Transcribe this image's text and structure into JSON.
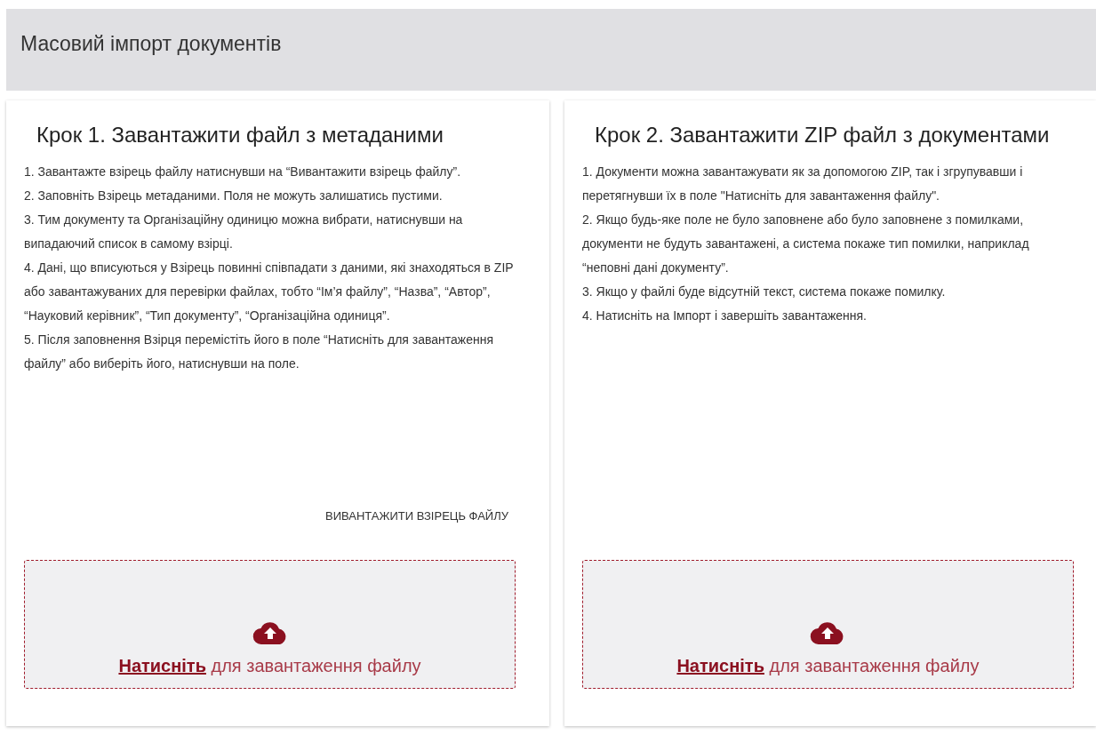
{
  "header": {
    "title": "Масовий імпорт документів"
  },
  "steps": [
    {
      "title": "Крок 1. Завантажити файл з метаданими",
      "items": [
        "1. Завантажте взірець файлу натиснувши на “Вивантажити взірець файлу”.",
        "2. Заповніть Взірець метаданими. Поля не можуть залишатись пустими.",
        "3. Тим документу та Організаційну одиницю можна вибрати, натиснувши на випадаючий список в самому взірці.",
        "4. Дані, що вписуються у Взірець повинні співпадати з даними, які знаходяться в ZIP або завантажуваних для перевірки файлах, тобто “Ім’я файлу”, “Назва”, “Автор”, “Науковий керівник”, “Тип документу”, “Організаційна одиниця”.",
        "5. Після заповнення Взірця перемістіть його в поле “Натисніть для завантаження файлу” або виберіть його, натиснувши на поле."
      ],
      "action": "ВИВАНТАЖИТИ ВЗІРЕЦЬ ФАЙЛУ",
      "dropzone": {
        "link": "Натисніть",
        "text": "для завантаження файлу"
      }
    },
    {
      "title": "Крок 2. Завантажити ZIP файл з документами",
      "items": [
        "1. Документи можна завантажувати як за допомогою ZIP, так і згрупувавши і перетягнувши їх в поле \"Натисніть для завантаження файлу\".",
        "2. Якщо будь-яке поле не було заповнене або було заповнене з помилками, документи не будуть завантажені, а система покаже тип помилки, наприклад “неповні дані документу”.",
        "3. Якщо у файлі буде відсутній текст, система покаже помилку.",
        "4. Натисніть на Імпорт і завершіть завантаження."
      ],
      "dropzone": {
        "link": "Натисніть",
        "text": "для завантаження файлу"
      }
    }
  ]
}
